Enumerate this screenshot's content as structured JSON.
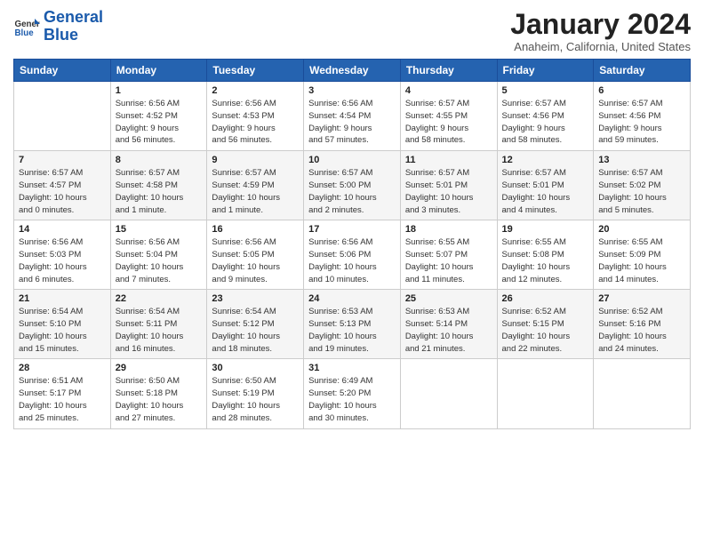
{
  "logo": {
    "text_general": "General",
    "text_blue": "Blue"
  },
  "header": {
    "title": "January 2024",
    "subtitle": "Anaheim, California, United States"
  },
  "weekdays": [
    "Sunday",
    "Monday",
    "Tuesday",
    "Wednesday",
    "Thursday",
    "Friday",
    "Saturday"
  ],
  "weeks": [
    [
      {
        "num": "",
        "sunrise": "",
        "sunset": "",
        "daylight": ""
      },
      {
        "num": "1",
        "sunrise": "Sunrise: 6:56 AM",
        "sunset": "Sunset: 4:52 PM",
        "daylight": "Daylight: 9 hours and 56 minutes."
      },
      {
        "num": "2",
        "sunrise": "Sunrise: 6:56 AM",
        "sunset": "Sunset: 4:53 PM",
        "daylight": "Daylight: 9 hours and 56 minutes."
      },
      {
        "num": "3",
        "sunrise": "Sunrise: 6:56 AM",
        "sunset": "Sunset: 4:54 PM",
        "daylight": "Daylight: 9 hours and 57 minutes."
      },
      {
        "num": "4",
        "sunrise": "Sunrise: 6:57 AM",
        "sunset": "Sunset: 4:55 PM",
        "daylight": "Daylight: 9 hours and 58 minutes."
      },
      {
        "num": "5",
        "sunrise": "Sunrise: 6:57 AM",
        "sunset": "Sunset: 4:56 PM",
        "daylight": "Daylight: 9 hours and 58 minutes."
      },
      {
        "num": "6",
        "sunrise": "Sunrise: 6:57 AM",
        "sunset": "Sunset: 4:56 PM",
        "daylight": "Daylight: 9 hours and 59 minutes."
      }
    ],
    [
      {
        "num": "7",
        "sunrise": "Sunrise: 6:57 AM",
        "sunset": "Sunset: 4:57 PM",
        "daylight": "Daylight: 10 hours and 0 minutes."
      },
      {
        "num": "8",
        "sunrise": "Sunrise: 6:57 AM",
        "sunset": "Sunset: 4:58 PM",
        "daylight": "Daylight: 10 hours and 1 minute."
      },
      {
        "num": "9",
        "sunrise": "Sunrise: 6:57 AM",
        "sunset": "Sunset: 4:59 PM",
        "daylight": "Daylight: 10 hours and 1 minute."
      },
      {
        "num": "10",
        "sunrise": "Sunrise: 6:57 AM",
        "sunset": "Sunset: 5:00 PM",
        "daylight": "Daylight: 10 hours and 2 minutes."
      },
      {
        "num": "11",
        "sunrise": "Sunrise: 6:57 AM",
        "sunset": "Sunset: 5:01 PM",
        "daylight": "Daylight: 10 hours and 3 minutes."
      },
      {
        "num": "12",
        "sunrise": "Sunrise: 6:57 AM",
        "sunset": "Sunset: 5:01 PM",
        "daylight": "Daylight: 10 hours and 4 minutes."
      },
      {
        "num": "13",
        "sunrise": "Sunrise: 6:57 AM",
        "sunset": "Sunset: 5:02 PM",
        "daylight": "Daylight: 10 hours and 5 minutes."
      }
    ],
    [
      {
        "num": "14",
        "sunrise": "Sunrise: 6:56 AM",
        "sunset": "Sunset: 5:03 PM",
        "daylight": "Daylight: 10 hours and 6 minutes."
      },
      {
        "num": "15",
        "sunrise": "Sunrise: 6:56 AM",
        "sunset": "Sunset: 5:04 PM",
        "daylight": "Daylight: 10 hours and 7 minutes."
      },
      {
        "num": "16",
        "sunrise": "Sunrise: 6:56 AM",
        "sunset": "Sunset: 5:05 PM",
        "daylight": "Daylight: 10 hours and 9 minutes."
      },
      {
        "num": "17",
        "sunrise": "Sunrise: 6:56 AM",
        "sunset": "Sunset: 5:06 PM",
        "daylight": "Daylight: 10 hours and 10 minutes."
      },
      {
        "num": "18",
        "sunrise": "Sunrise: 6:55 AM",
        "sunset": "Sunset: 5:07 PM",
        "daylight": "Daylight: 10 hours and 11 minutes."
      },
      {
        "num": "19",
        "sunrise": "Sunrise: 6:55 AM",
        "sunset": "Sunset: 5:08 PM",
        "daylight": "Daylight: 10 hours and 12 minutes."
      },
      {
        "num": "20",
        "sunrise": "Sunrise: 6:55 AM",
        "sunset": "Sunset: 5:09 PM",
        "daylight": "Daylight: 10 hours and 14 minutes."
      }
    ],
    [
      {
        "num": "21",
        "sunrise": "Sunrise: 6:54 AM",
        "sunset": "Sunset: 5:10 PM",
        "daylight": "Daylight: 10 hours and 15 minutes."
      },
      {
        "num": "22",
        "sunrise": "Sunrise: 6:54 AM",
        "sunset": "Sunset: 5:11 PM",
        "daylight": "Daylight: 10 hours and 16 minutes."
      },
      {
        "num": "23",
        "sunrise": "Sunrise: 6:54 AM",
        "sunset": "Sunset: 5:12 PM",
        "daylight": "Daylight: 10 hours and 18 minutes."
      },
      {
        "num": "24",
        "sunrise": "Sunrise: 6:53 AM",
        "sunset": "Sunset: 5:13 PM",
        "daylight": "Daylight: 10 hours and 19 minutes."
      },
      {
        "num": "25",
        "sunrise": "Sunrise: 6:53 AM",
        "sunset": "Sunset: 5:14 PM",
        "daylight": "Daylight: 10 hours and 21 minutes."
      },
      {
        "num": "26",
        "sunrise": "Sunrise: 6:52 AM",
        "sunset": "Sunset: 5:15 PM",
        "daylight": "Daylight: 10 hours and 22 minutes."
      },
      {
        "num": "27",
        "sunrise": "Sunrise: 6:52 AM",
        "sunset": "Sunset: 5:16 PM",
        "daylight": "Daylight: 10 hours and 24 minutes."
      }
    ],
    [
      {
        "num": "28",
        "sunrise": "Sunrise: 6:51 AM",
        "sunset": "Sunset: 5:17 PM",
        "daylight": "Daylight: 10 hours and 25 minutes."
      },
      {
        "num": "29",
        "sunrise": "Sunrise: 6:50 AM",
        "sunset": "Sunset: 5:18 PM",
        "daylight": "Daylight: 10 hours and 27 minutes."
      },
      {
        "num": "30",
        "sunrise": "Sunrise: 6:50 AM",
        "sunset": "Sunset: 5:19 PM",
        "daylight": "Daylight: 10 hours and 28 minutes."
      },
      {
        "num": "31",
        "sunrise": "Sunrise: 6:49 AM",
        "sunset": "Sunset: 5:20 PM",
        "daylight": "Daylight: 10 hours and 30 minutes."
      },
      {
        "num": "",
        "sunrise": "",
        "sunset": "",
        "daylight": ""
      },
      {
        "num": "",
        "sunrise": "",
        "sunset": "",
        "daylight": ""
      },
      {
        "num": "",
        "sunrise": "",
        "sunset": "",
        "daylight": ""
      }
    ]
  ]
}
